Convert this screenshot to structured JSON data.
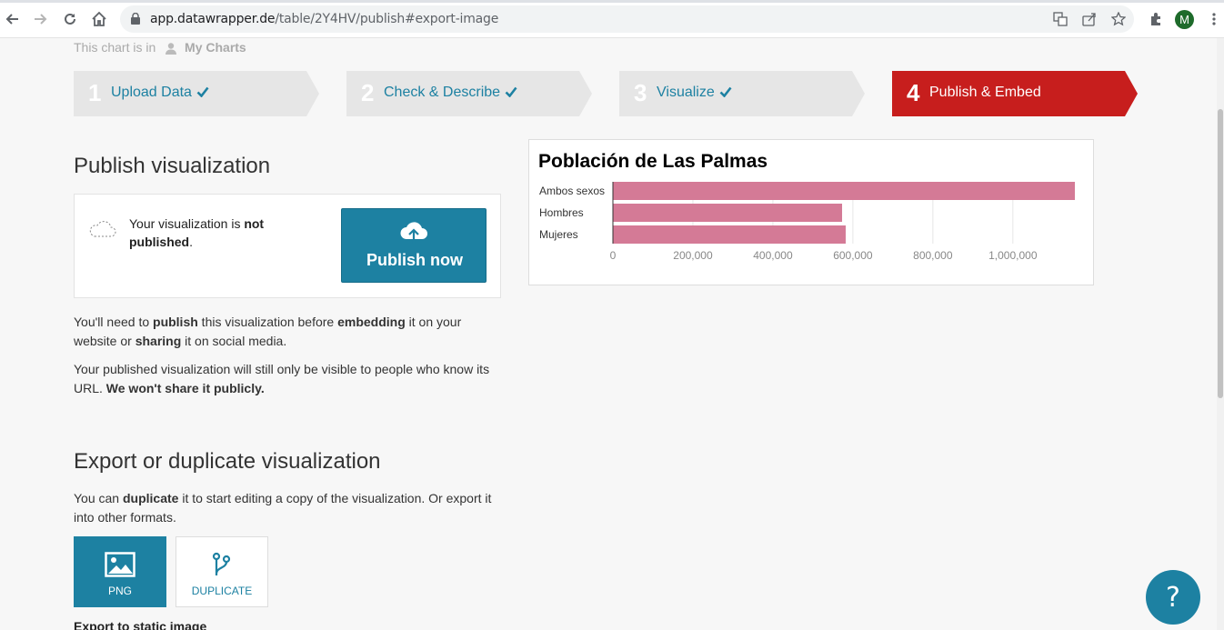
{
  "browser": {
    "url_host": "app.datawrapper.de",
    "url_path": "/table/2Y4HV/publish#export-image",
    "avatar_letter": "M"
  },
  "header": {
    "chart_is_in": "This chart is in",
    "folder": "My Charts"
  },
  "steps": [
    {
      "num": "1",
      "label": "Upload Data",
      "done": true
    },
    {
      "num": "2",
      "label": "Check & Describe",
      "done": true
    },
    {
      "num": "3",
      "label": "Visualize",
      "done": true
    },
    {
      "num": "4",
      "label": "Publish & Embed",
      "active": true
    }
  ],
  "publish": {
    "heading": "Publish visualization",
    "status_pre": "Your visualization is ",
    "status_bold": "not published",
    "status_post": ".",
    "button_label": "Publish now",
    "p1": [
      {
        "t": "You'll need to "
      },
      {
        "t": "publish",
        "b": true
      },
      {
        "t": " this visualization before "
      },
      {
        "t": "embedding",
        "b": true
      },
      {
        "t": " it on your website or "
      },
      {
        "t": "sharing",
        "b": true
      },
      {
        "t": " it on social media."
      }
    ],
    "p2": [
      {
        "t": "Your published visualization will still only be visible to people who know its URL. "
      },
      {
        "t": "We won't share it publicly.",
        "b": true
      }
    ]
  },
  "export": {
    "heading": "Export or duplicate visualization",
    "p1": [
      {
        "t": "You can "
      },
      {
        "t": "duplicate",
        "b": true
      },
      {
        "t": " it to start editing a copy of the visualization. Or export it into other formats."
      }
    ],
    "png_label": "PNG",
    "duplicate_label": "DUPLICATE",
    "static_heading": "Export to static image"
  },
  "chart_data": {
    "type": "bar",
    "orientation": "horizontal",
    "title": "Población de Las Palmas",
    "categories": [
      "Ambos sexos",
      "Hombres",
      "Mujeres"
    ],
    "values": [
      1155000,
      573000,
      582000
    ],
    "xlim": [
      0,
      1155000
    ],
    "xticks": [
      0,
      200000,
      400000,
      600000,
      800000,
      1000000
    ],
    "tick_labels": [
      "0",
      "200,000",
      "400,000",
      "600,000",
      "800,000",
      "1,000,000"
    ],
    "bar_color": "#d47a96",
    "grid": true
  },
  "help_label": "?"
}
